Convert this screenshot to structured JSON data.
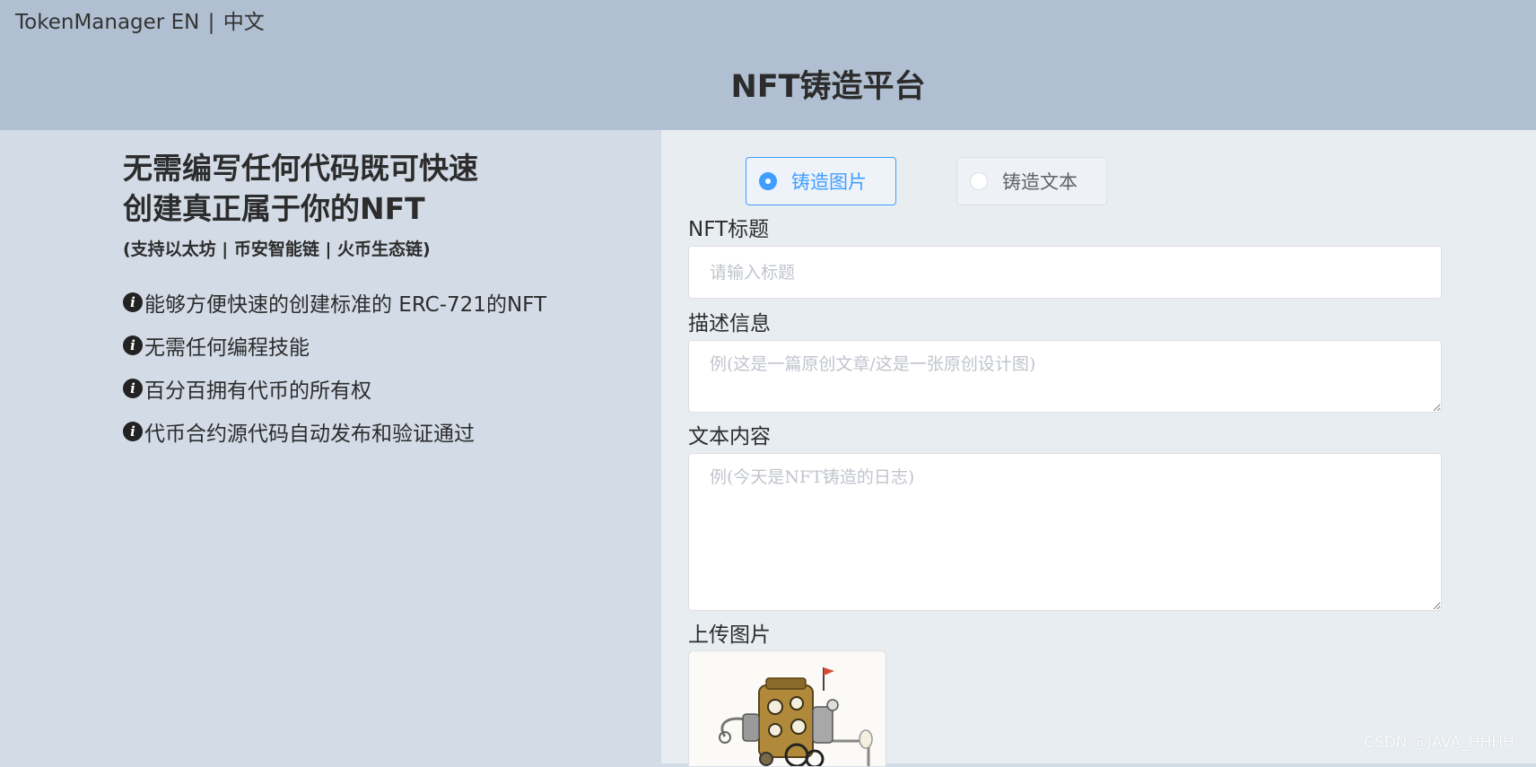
{
  "header": {
    "brand": "TokenManager",
    "lang_en": "EN",
    "lang_sep": "|",
    "lang_zh": "中文",
    "title": "NFT铸造平台"
  },
  "intro": {
    "headline": "无需编写任何代码既可快速创建真正属于你的NFT",
    "chains": "(支持以太坊 | 币安智能链 | 火币生态链)",
    "features": [
      "能够方便快速的创建标准的 ERC-721的NFT",
      "无需任何编程技能",
      "百分百拥有代币的所有权",
      "代币合约源代码自动发布和验证通过"
    ]
  },
  "form": {
    "modes": [
      {
        "label": "铸造图片",
        "selected": true
      },
      {
        "label": "铸造文本",
        "selected": false
      }
    ],
    "title_label": "NFT标题",
    "title_placeholder": "请输入标题",
    "title_value": "",
    "desc_label": "描述信息",
    "desc_placeholder": "例(这是一篇原创文章/这是一张原创设计图)",
    "desc_value": "",
    "content_label": "文本内容",
    "content_placeholder": "例(今天是NFT铸造的日志)",
    "content_value": "",
    "upload_label": "上传图片",
    "upload_image_icon": "steampunk-machine-image"
  },
  "colors": {
    "header_bg": "#b0bfd1",
    "left_bg": "#d2dbe6",
    "right_bg": "#e8edf2",
    "accent": "#409eff"
  },
  "watermark": "CSDN @JAVA_HHHH"
}
